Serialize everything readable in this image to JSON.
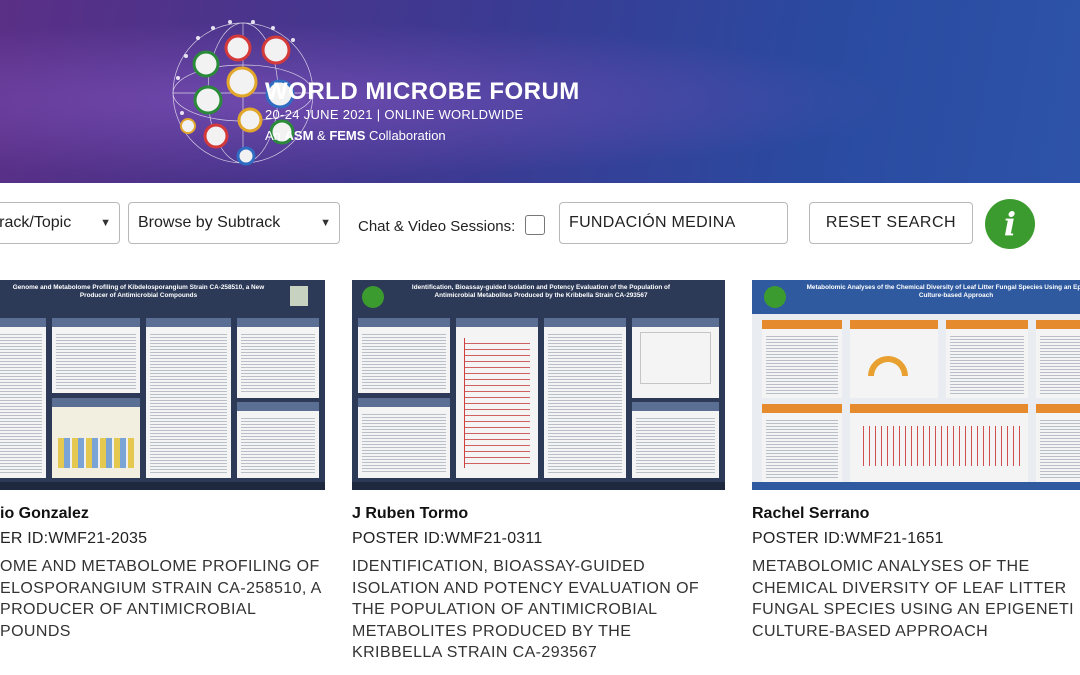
{
  "banner": {
    "title": "WORLD MICROBE FORUM",
    "date_line": "20-24 JUNE 2021  |  ONLINE WORLDWIDE",
    "collab_prefix": "An ",
    "collab_asm": "ASM",
    "collab_and": " & ",
    "collab_fems": "FEMS",
    "collab_suffix": " Collaboration"
  },
  "filters": {
    "track_select": "Track/Topic",
    "subtrack_select": "Browse by Subtrack",
    "chat_label": "Chat & Video Sessions:",
    "chat_checked": false,
    "search_value": "FUNDACIÓN MEDINA",
    "reset_label": "RESET SEARCH",
    "info_glyph": "i"
  },
  "colors": {
    "accent_green": "#3c9b2e",
    "banner_purple": "#5a2f86",
    "banner_blue": "#2d53a8"
  },
  "posters": [
    {
      "author": "io Gonzalez",
      "poster_id": "ER ID:WMF21-2035",
      "title": "OME AND METABOLOME PROFILING OF\nELOSPORANGIUM STRAIN CA-258510, A\nPRODUCER OF ANTIMICROBIAL\nPOUNDS",
      "thumb_title": "Genome and Metabolome Profiling of Kibdelosporangium Strain CA-258510, a New Producer of Antimicrobial Compounds"
    },
    {
      "author": "J Ruben Tormo",
      "poster_id": "POSTER ID:WMF21-0311",
      "title": "IDENTIFICATION, BIOASSAY-GUIDED\nISOLATION AND POTENCY EVALUATION OF\nTHE POPULATION OF ANTIMICROBIAL\nMETABOLITES PRODUCED BY THE\nKRIBBELLA STRAIN CA-293567",
      "thumb_title": "Identification, Bioassay-guided Isolation and Potency Evaluation of the Population of Antimicrobial Metabolites Produced by the Kribbella Strain CA-293567"
    },
    {
      "author": "Rachel Serrano",
      "poster_id": "POSTER ID:WMF21-1651",
      "title": "METABOLOMIC ANALYSES OF THE\nCHEMICAL DIVERSITY OF LEAF LITTER\nFUNGAL SPECIES USING AN EPIGENETI\nCULTURE-BASED APPROACH",
      "thumb_title": "Metabolomic Analyses of the Chemical Diversity of Leaf Litter Fungal Species Using an Epigenetic Culture-based Approach"
    }
  ]
}
